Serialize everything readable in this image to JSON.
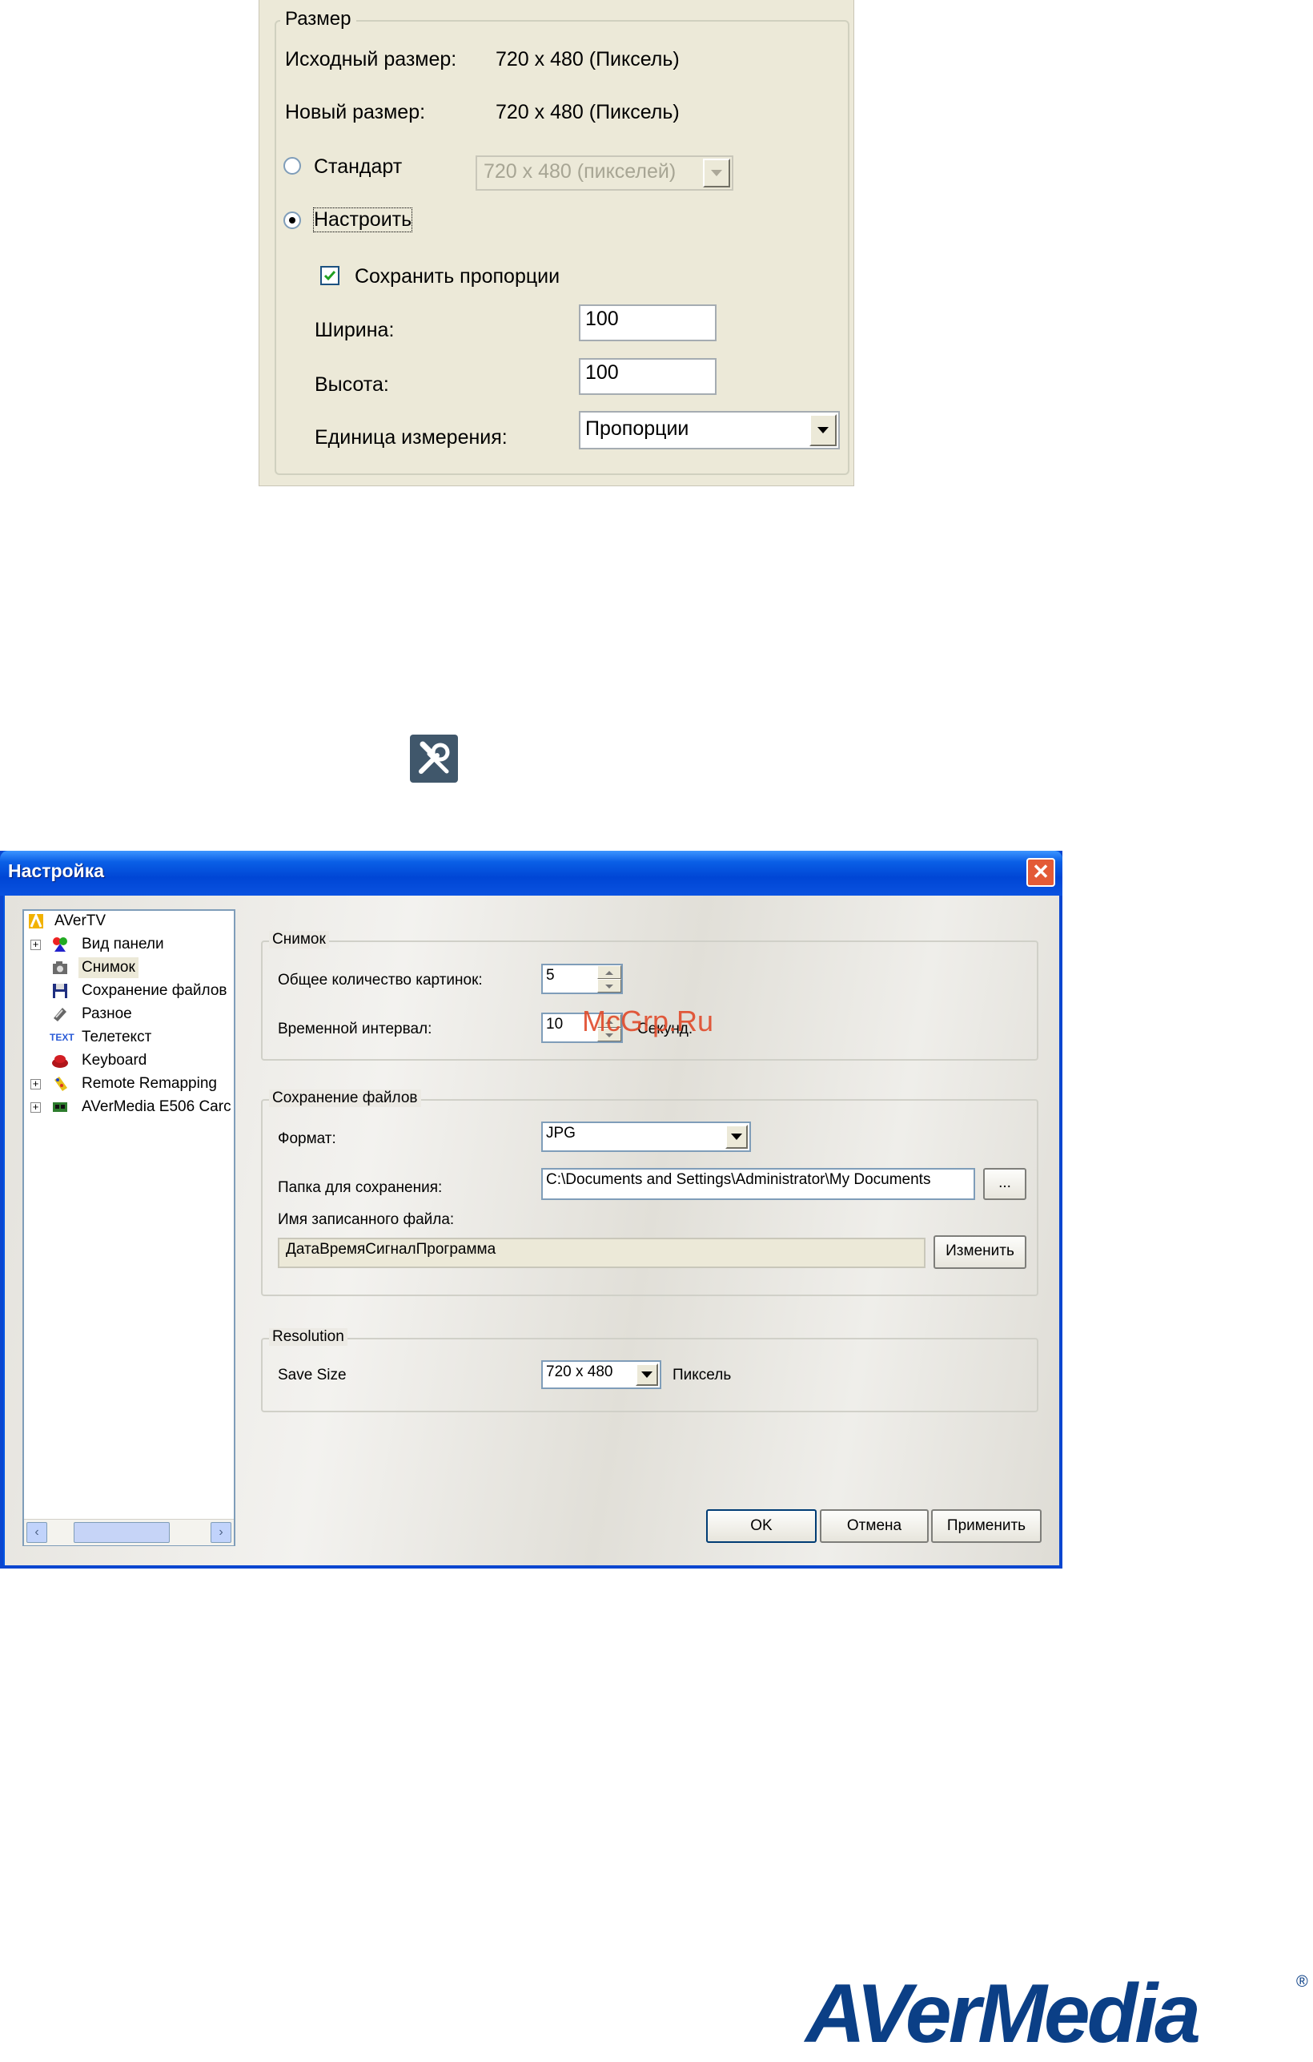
{
  "size_panel": {
    "group_title": "Размер",
    "original_size_label": "Исходный размер:",
    "original_size_value": "720 x 480 (Пиксель)",
    "new_size_label": "Новый размер:",
    "new_size_value": "720 x 480 (Пиксель)",
    "radio_standard": {
      "label": "Стандарт",
      "selected": false
    },
    "standard_select_value": "720 x 480 (пикселей)",
    "radio_custom": {
      "label": "Настроить",
      "selected": true
    },
    "keep_ratio": {
      "label": "Сохранить пропорции",
      "checked": true
    },
    "width_label": "Ширина:",
    "width_value": "100",
    "height_label": "Высота:",
    "height_value": "100",
    "unit_label": "Единица измерения:",
    "unit_value": "Пропорции"
  },
  "tools_icon": "tools-icon",
  "dialog": {
    "title": "Настройка",
    "tree": [
      {
        "label": "AVerTV",
        "icon": "avertv-icon",
        "expander": false
      },
      {
        "label": "Вид панели",
        "icon": "panel-view-icon",
        "expander": true
      },
      {
        "label": "Снимок",
        "icon": "camera-icon",
        "expander": false,
        "selected": true
      },
      {
        "label": "Сохранение файлов",
        "icon": "floppy-icon",
        "expander": false
      },
      {
        "label": "Разное",
        "icon": "misc-icon",
        "expander": false
      },
      {
        "label": "Телетекст",
        "icon": "teletext-icon",
        "icon_text": "TEXT",
        "expander": false
      },
      {
        "label": "Keyboard",
        "icon": "keyboard-icon",
        "expander": false
      },
      {
        "label": "Remote Remapping",
        "icon": "remote-icon",
        "expander": true
      },
      {
        "label": "AVerMedia E506 Carc",
        "icon": "card-icon",
        "expander": true
      }
    ],
    "snapshot": {
      "group_title": "Снимок",
      "count_label": "Общее количество картинок:",
      "count_value": "5",
      "interval_label": "Временной интервал:",
      "interval_value": "10",
      "interval_unit": "Секунд."
    },
    "file_saving": {
      "group_title": "Сохранение файлов",
      "format_label": "Формат:",
      "format_value": "JPG",
      "folder_label": "Папка для сохранения:",
      "folder_value": "C:\\Documents and Settings\\Administrator\\My Documents",
      "browse_label": "...",
      "filename_label": "Имя записанного файла:",
      "filename_value": "ДатаВремяСигналПрограмма",
      "change_label": "Изменить"
    },
    "resolution": {
      "group_title": "Resolution",
      "save_size_label": "Save Size",
      "save_size_value": "720 x 480",
      "unit": "Пиксель"
    },
    "buttons": {
      "ok": "OK",
      "cancel": "Отмена",
      "apply": "Применить"
    },
    "watermark": "McGrp.Ru"
  },
  "logo": {
    "text": "AVerMedia",
    "reg": "®"
  },
  "colors": {
    "titlebar": "#0054e3",
    "close": "#e35a36",
    "logo": "#0b3f86"
  }
}
